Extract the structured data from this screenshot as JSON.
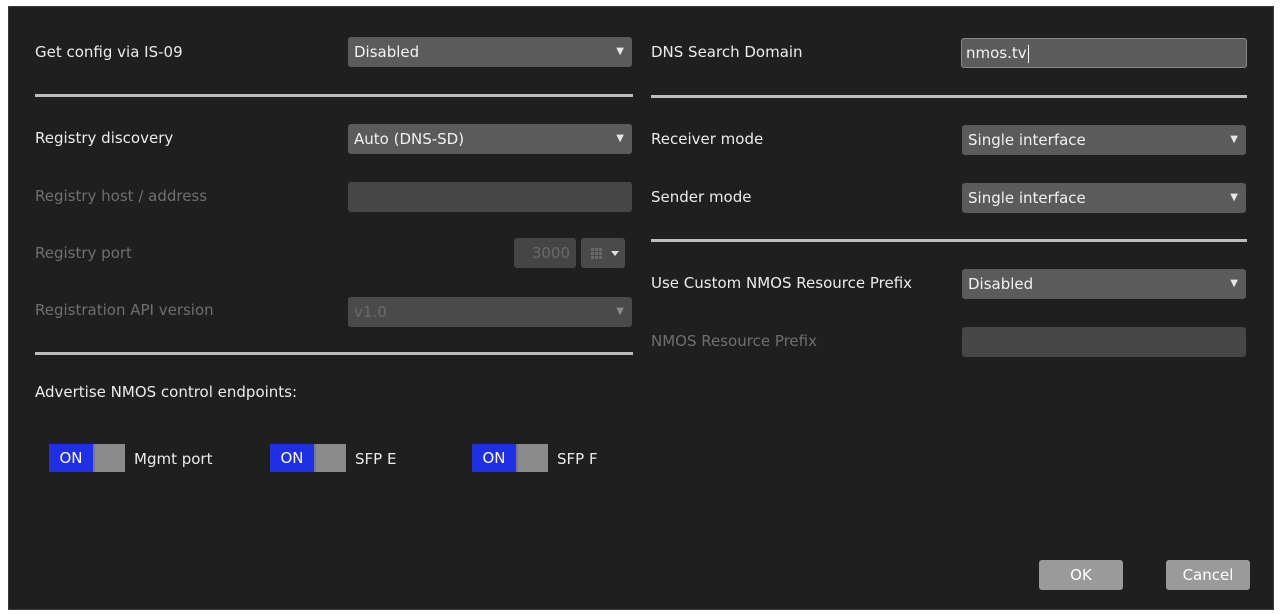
{
  "left": {
    "get_config": {
      "label": "Get config via IS-09",
      "value": "Disabled"
    },
    "registry_discovery": {
      "label": "Registry discovery",
      "value": "Auto (DNS-SD)"
    },
    "registry_host": {
      "label": "Registry host / address",
      "value": ""
    },
    "registry_port": {
      "label": "Registry port",
      "value": "3000"
    },
    "registration_api": {
      "label": "Registration API version",
      "value": "v1.0"
    },
    "advertise": {
      "label": "Advertise NMOS control endpoints:",
      "toggles": [
        {
          "state": "ON",
          "label": "Mgmt port"
        },
        {
          "state": "ON",
          "label": "SFP E"
        },
        {
          "state": "ON",
          "label": "SFP F"
        }
      ]
    }
  },
  "right": {
    "dns_search_domain": {
      "label": "DNS Search Domain",
      "value": "nmos.tv"
    },
    "receiver_mode": {
      "label": "Receiver mode",
      "value": "Single interface"
    },
    "sender_mode": {
      "label": "Sender mode",
      "value": "Single interface"
    },
    "custom_prefix": {
      "label": "Use Custom NMOS Resource Prefix",
      "value": "Disabled"
    },
    "resource_prefix": {
      "label": "NMOS Resource Prefix",
      "value": ""
    }
  },
  "footer": {
    "ok_label": "OK",
    "cancel_label": "Cancel"
  },
  "colors": {
    "background": "#1f1f1f",
    "toggle_on": "#1f2fe6",
    "dropdown": "#5b5b5b"
  }
}
